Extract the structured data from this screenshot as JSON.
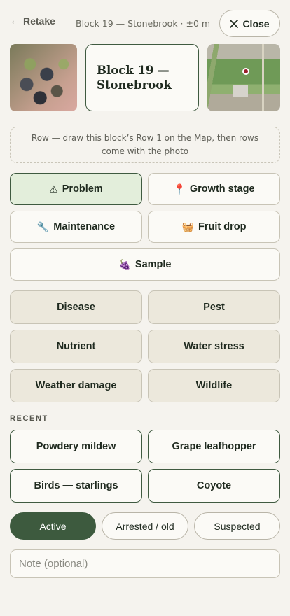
{
  "header": {
    "retake_label": "Retake",
    "breadcrumb": "Block 19 — Stonebrook · ±0 m",
    "close_label": "Close"
  },
  "block_card": {
    "title": "Block 19 —\nStonebrook"
  },
  "row_hint": "Row — draw this block’s Row 1 on the Map, then rows come with the photo",
  "observation_types": [
    {
      "label": "Problem",
      "icon": "⚠",
      "icon_name": "warning-icon",
      "selected": true
    },
    {
      "label": "Growth stage",
      "icon": "📍",
      "icon_name": "pin-icon",
      "selected": false
    },
    {
      "label": "Maintenance",
      "icon": "🔧",
      "icon_name": "wrench-icon",
      "selected": false
    },
    {
      "label": "Fruit drop",
      "icon": "🧺",
      "icon_name": "basket-icon",
      "selected": false
    },
    {
      "label": "Sample",
      "icon": "🍇",
      "icon_name": "grapes-icon",
      "selected": false
    }
  ],
  "categories": [
    "Disease",
    "Pest",
    "Nutrient",
    "Water stress",
    "Weather damage",
    "Wildlife"
  ],
  "recent": {
    "label": "RECENT",
    "items": [
      "Powdery mildew",
      "Grape leafhopper",
      "Birds — starlings",
      "Coyote"
    ]
  },
  "status": {
    "options": [
      "Active",
      "Arrested / old",
      "Suspected"
    ],
    "selected": "Active"
  },
  "note": {
    "placeholder": "Note (optional)",
    "value": ""
  },
  "colors": {
    "accent": "#3d5a3e",
    "selected_bg": "#e3eedb",
    "category_bg": "#ece8dc",
    "page_bg": "#f5f3ee"
  }
}
